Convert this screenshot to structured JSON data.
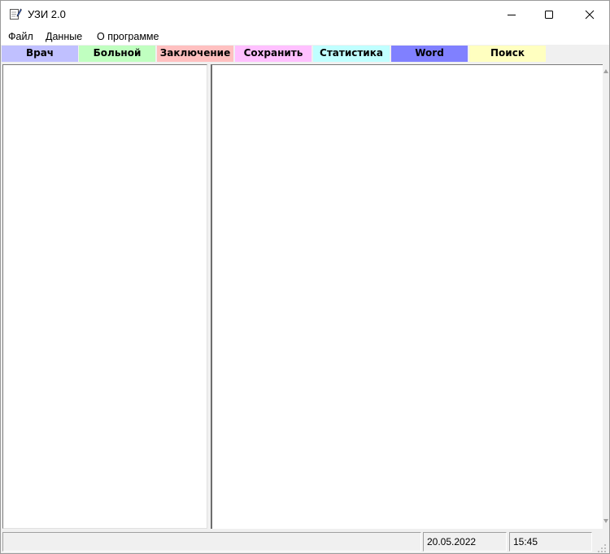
{
  "window": {
    "title": "УЗИ 2.0"
  },
  "menu": [
    "Файл",
    "Данные",
    "О программе"
  ],
  "toolbar": [
    {
      "label": "Врач",
      "color": "#c0c0ff"
    },
    {
      "label": "Больной",
      "color": "#c0ffc0"
    },
    {
      "label": "Заключение",
      "color": "#ffc0c0"
    },
    {
      "label": "Сохранить",
      "color": "#ffc0ff"
    },
    {
      "label": "Статистика",
      "color": "#c0ffff"
    },
    {
      "label": "Word",
      "color": "#8080ff"
    },
    {
      "label": "Поиск",
      "color": "#ffffc0"
    }
  ],
  "status": {
    "message": "",
    "date": "20.05.2022",
    "time": "15:45"
  },
  "icons": {
    "app": "notepad-pencil-icon",
    "minimize": "minimize-icon",
    "maximize": "maximize-icon",
    "close": "close-icon"
  }
}
